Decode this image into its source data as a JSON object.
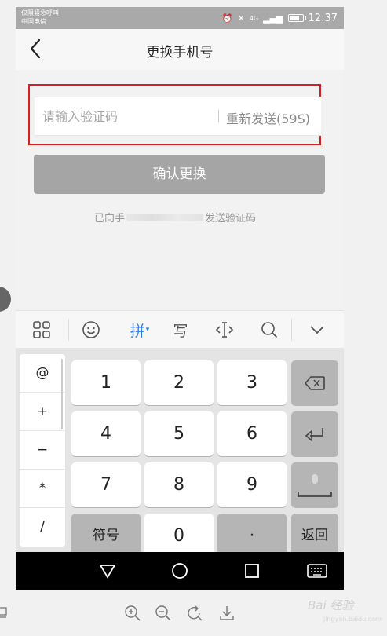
{
  "status_bar": {
    "line1": "仅限紧急呼叫",
    "line2": "中国电信",
    "time": "12:37",
    "network": "4G"
  },
  "header": {
    "title": "更换手机号",
    "back_icon": "chevron-left-icon"
  },
  "form": {
    "code_placeholder": "请输入验证码",
    "code_value": "",
    "resend_label": "重新发送(59S)",
    "confirm_label": "确认更换",
    "hint_prefix": "已向手",
    "hint_suffix": "发送验证码"
  },
  "keyboard_toolbar": {
    "items": [
      "grid-icon",
      "emoji-icon",
      "拼",
      "写",
      "cursor-icon",
      "search-icon",
      "chevron-down-icon"
    ]
  },
  "keyboard": {
    "side_keys": [
      "@",
      "+",
      "−",
      "*",
      "/"
    ],
    "digits": [
      "1",
      "2",
      "3",
      "4",
      "5",
      "6",
      "7",
      "8",
      "9",
      "0"
    ],
    "dot": "·",
    "symbol_label": "符号",
    "return_label": "返回",
    "accent_color": "#2b7de9"
  },
  "watermark": {
    "text": "Bai 经验",
    "sub": "jingyan.baidu.com"
  }
}
